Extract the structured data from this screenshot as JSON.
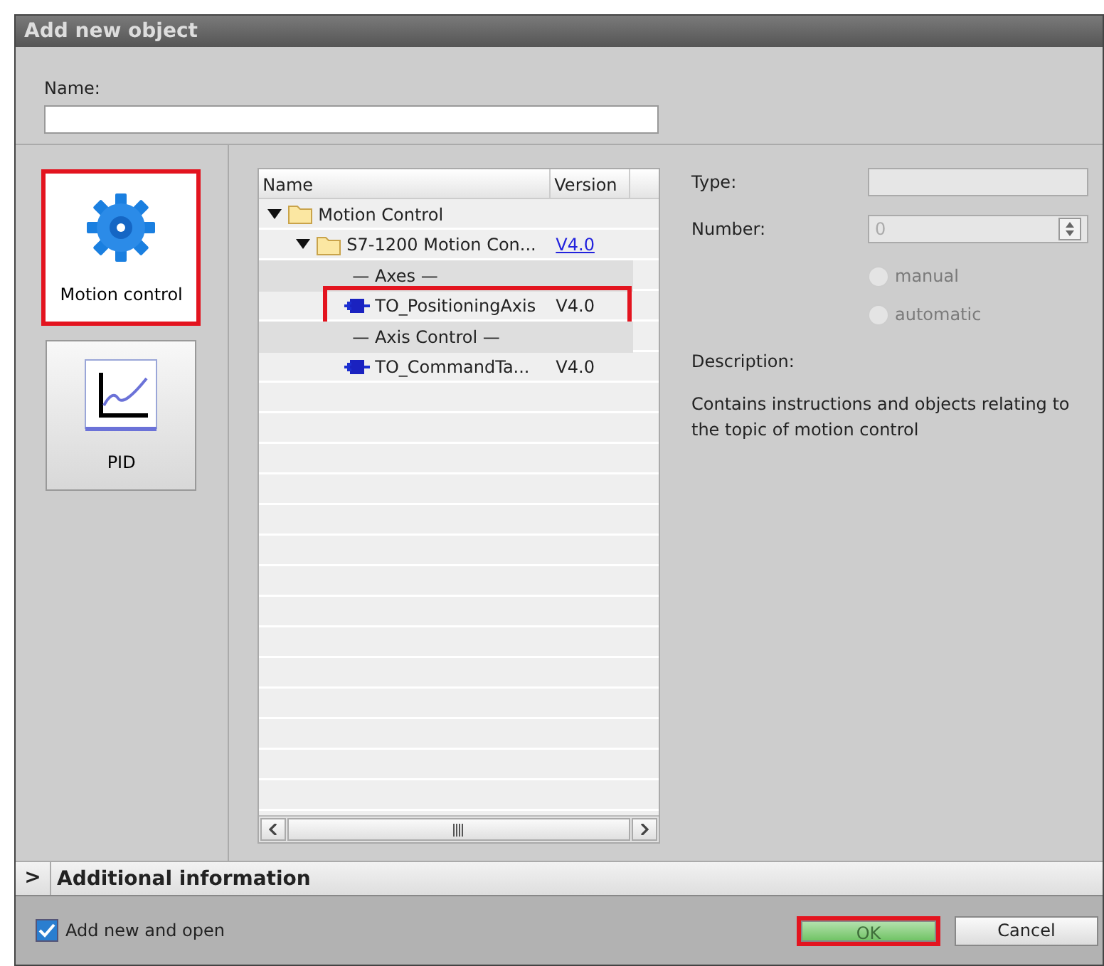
{
  "window": {
    "title": "Add new object"
  },
  "name_field": {
    "label": "Name:"
  },
  "categories": [
    {
      "label": "Motion control",
      "kind": "gear",
      "selected": true,
      "highlighted": true
    },
    {
      "label": "PID",
      "kind": "chart",
      "selected": false,
      "highlighted": false
    }
  ],
  "tree": {
    "columns": [
      "Name",
      "Version"
    ],
    "rows": [
      {
        "label": "Motion Control",
        "kind": "folder",
        "expanded": true,
        "children": [
          {
            "label": "S7-1200 Motion Con...",
            "kind": "folder",
            "expanded": true,
            "version": "V4.0",
            "children": [
              {
                "label": "— Axes —",
                "kind": "separator"
              },
              {
                "label": "TO_PositioningAxis",
                "kind": "object",
                "version": "V4.0",
                "highlighted": true
              },
              {
                "label": "— Axis Control —",
                "kind": "separator"
              },
              {
                "label": "TO_CommandTa...",
                "kind": "object",
                "version": "V4.0",
                "highlighted": false
              }
            ]
          }
        ]
      }
    ]
  },
  "details": {
    "type_label": "Type:",
    "number_label": "Number:",
    "number_value": "0",
    "radios": [
      {
        "label": "manual",
        "selected": false,
        "disabled": true
      },
      {
        "label": "automatic",
        "selected": false,
        "disabled": true
      }
    ],
    "description_label": "Description:",
    "description": "Contains instructions and objects relating to the topic of motion control"
  },
  "additional_info": {
    "label": "Additional information",
    "expanded": false,
    "toggle": ">"
  },
  "footer": {
    "checkbox": {
      "label": "Add new and open",
      "checked": true
    },
    "buttons": [
      {
        "label": "OK",
        "kind": "primary",
        "disabled": true,
        "highlighted": true
      },
      {
        "label": "Cancel",
        "kind": "secondary",
        "disabled": false,
        "highlighted": false
      }
    ]
  }
}
